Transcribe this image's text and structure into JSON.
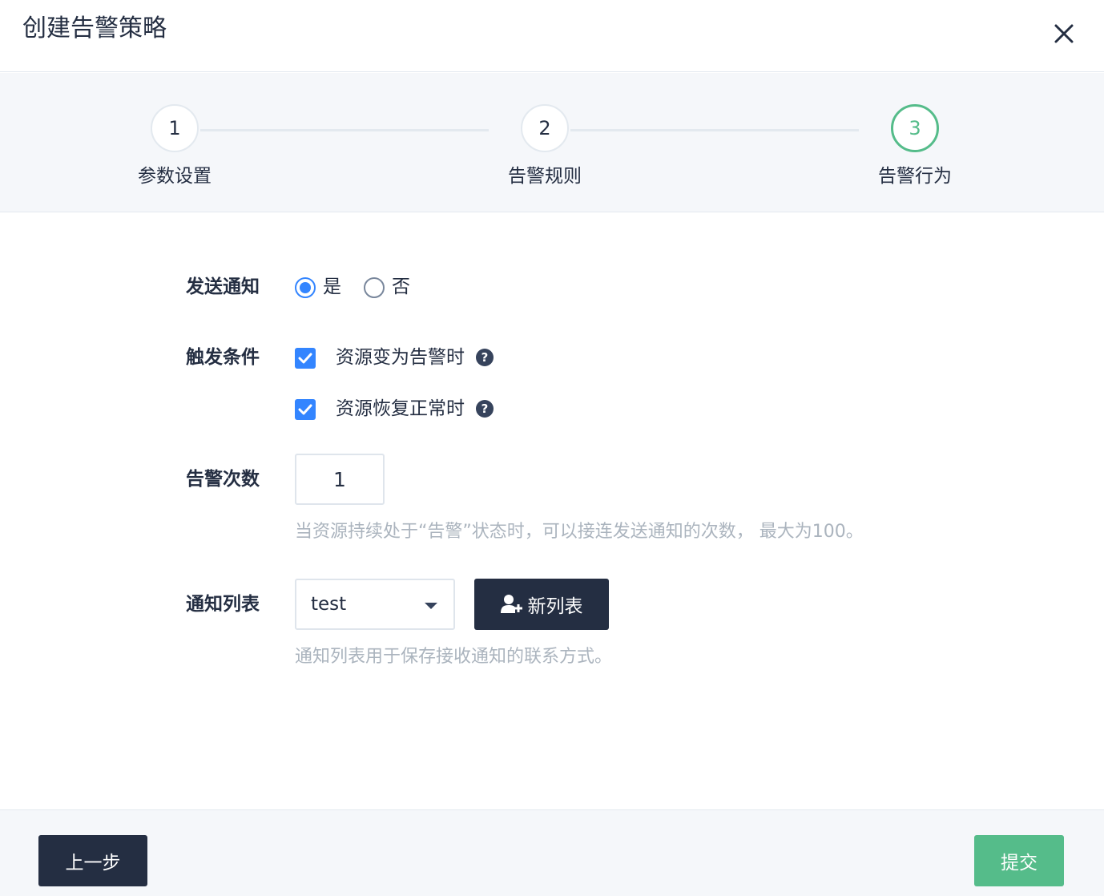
{
  "dialog": {
    "title": "创建告警策略"
  },
  "steps": [
    {
      "number": "1",
      "label": "参数设置"
    },
    {
      "number": "2",
      "label": "告警规则"
    },
    {
      "number": "3",
      "label": "告警行为"
    }
  ],
  "form": {
    "send_notification": {
      "label": "发送通知",
      "options": [
        {
          "label": "是",
          "checked": true
        },
        {
          "label": "否",
          "checked": false
        }
      ]
    },
    "trigger_condition": {
      "label": "触发条件",
      "options": [
        {
          "label": "资源变为告警时",
          "checked": true
        },
        {
          "label": "资源恢复正常时",
          "checked": true
        }
      ],
      "help_glyph": "?"
    },
    "alert_count": {
      "label": "告警次数",
      "value": "1",
      "hint": "当资源持续处于“告警”状态时，可以接连发送通知的次数， 最大为100。"
    },
    "notification_list": {
      "label": "通知列表",
      "selected": "test",
      "new_list_button": "新列表",
      "hint": "通知列表用于保存接收通知的联系方式。"
    }
  },
  "footer": {
    "prev_button": "上一步",
    "submit_button": "提交"
  },
  "colors": {
    "primary_dark": "#242e42",
    "success_green": "#55bc8a",
    "checkbox_blue": "#3385ff",
    "hint_gray": "#abb4be",
    "panel_bg": "#f5f7fa"
  }
}
